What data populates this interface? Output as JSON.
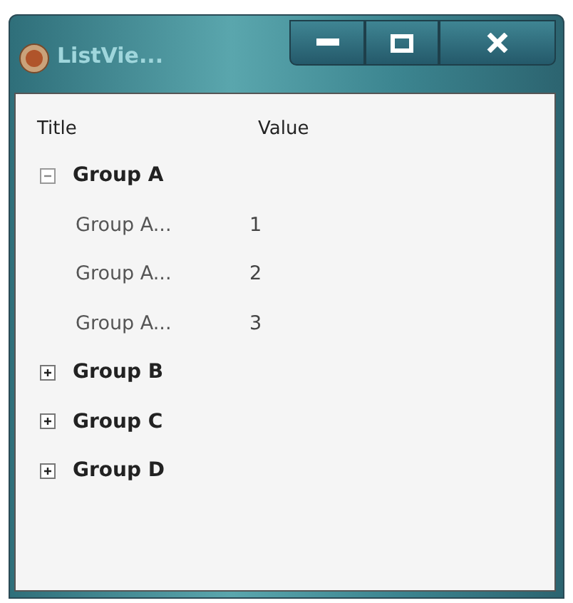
{
  "window": {
    "title": "ListVie..."
  },
  "table": {
    "columns": [
      "Title",
      "Value"
    ],
    "groups": [
      {
        "title": "Group A",
        "expanded": true,
        "items": [
          {
            "title": "Group A...",
            "value": "1"
          },
          {
            "title": "Group A...",
            "value": "2"
          },
          {
            "title": "Group A...",
            "value": "3"
          }
        ]
      },
      {
        "title": "Group B",
        "expanded": false
      },
      {
        "title": "Group C",
        "expanded": false
      },
      {
        "title": "Group D",
        "expanded": false
      }
    ]
  }
}
